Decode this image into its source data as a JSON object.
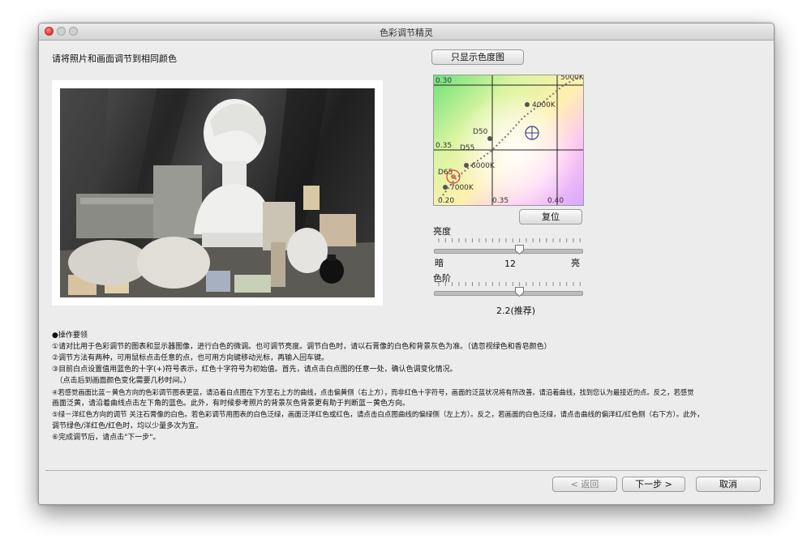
{
  "window": {
    "title": "色彩调节精灵"
  },
  "instruction_title": "请将照片和画面调节到相同颜色",
  "buttons": {
    "show_chart_only": "只显示色度图",
    "reset": "复位",
    "back": "< 返回",
    "next": "下一步 >",
    "cancel": "取消"
  },
  "chart": {
    "labels": [
      "0.30",
      "0.35",
      "0.35",
      "0.40",
      "0.20",
      "5000K",
      "4000K",
      "D50",
      "D55",
      "6000K",
      "D65",
      "7000K"
    ]
  },
  "brightness": {
    "label": "亮度",
    "dark": "暗",
    "bright": "亮",
    "value": "12",
    "level_fraction": 0.58
  },
  "gamma": {
    "label": "色阶",
    "value": "2.2(推荐)",
    "level_fraction": 0.58
  },
  "operations": {
    "lines": [
      "●操作要领",
      "①请对比用于色彩调节的图表和显示器图像，进行白色的微调。也可调节亮度。调节白色时，请以石膏像的白色和背景灰色为准。（请忽视绿色和香皂颜色）",
      "②调节方法有两种，可用鼠标点击任意的点，也可用方向键移动光标，再输入回车键。",
      "③目前白点设置值用蓝色的十字(+)符号表示，红色十字符号为初始值。首先，请点击白点图的任意一处，确认色调变化情况。",
      "　（点击后到画面颜色变化需要几秒时间。）",
      "④若感觉画面比蓝－黄色方向的色彩调节图表更蓝，请沿着白点图在下方至右上方的曲线，点击偏黄侧（右上方），而非红色十字符号，画面的泛蓝状况将有所改善。请沿着曲线，找到您认为最接近的点。反之，若感觉",
      "画面泛黄，请沿着曲线点击左下角的蓝色。此外，有时候参考照片的背景灰色背景更有助于判断蓝－黄色方向。",
      "⑤绿－洋红色方向的调节 关注石膏像的白色。若色彩调节用图表的白色泛绿，画面泛洋红色或红色，请点击白点图曲线的偏绿侧（左上方）。反之，若画面的白色泛绿，请点击曲线的偏洋红/红色侧（右下方）。此外，",
      "调节绿色/洋红色/红色时，均以少量多次为宜。",
      "⑥完成调节后，请点击\"下一步\"。"
    ]
  },
  "colors": {
    "window_bg": "#ececec",
    "white_point_current": "#3a3a8a",
    "white_point_initial": "#e03a3a"
  },
  "icons": [
    "close-button-icon",
    "minimize-button-icon",
    "zoom-button-icon",
    "crosshair-icon",
    "slider-thumb-icon"
  ]
}
